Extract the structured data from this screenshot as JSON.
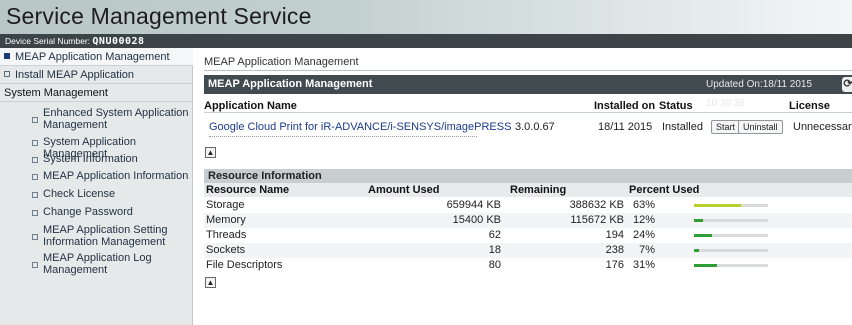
{
  "app_title": "Service Management Service",
  "serial": {
    "label": "Device Serial Number:",
    "value": "QNU00028"
  },
  "sidebar": {
    "top_items": [
      {
        "label": "MEAP Application Management",
        "active": true
      },
      {
        "label": "Install MEAP Application",
        "active": false
      }
    ],
    "section_header": "System Management",
    "sub_items": [
      {
        "label": "Enhanced System Application Management"
      },
      {
        "label": "System Application Management"
      },
      {
        "label": "System Information"
      },
      {
        "label": "MEAP Application Information"
      },
      {
        "label": "Check License"
      },
      {
        "label": "Change Password"
      },
      {
        "label": "MEAP Application Setting Information Management"
      },
      {
        "label": "MEAP Application Log Management"
      }
    ]
  },
  "main": {
    "breadcrumb": "MEAP Application Management",
    "panel_title": "MEAP Application Management",
    "updated": "Updated On:18/11 2015 10:39:38",
    "app_table": {
      "headers": {
        "name": "Application Name",
        "installed_on": "Installed on",
        "status": "Status",
        "license": "License"
      },
      "rows": [
        {
          "name": "Google Cloud Print for iR-ADVANCE/i-SENSYS/imagePRESS",
          "version": "3.0.0.67",
          "installed_on": "18/11 2015",
          "status": "Installed",
          "start_label": "Start",
          "uninstall_label": "Uninstall",
          "license": "Unnecessary"
        }
      ]
    },
    "resource": {
      "title": "Resource Information",
      "headers": {
        "name": "Resource Name",
        "used": "Amount Used",
        "remaining": "Remaining",
        "percent": "Percent Used"
      },
      "rows": [
        {
          "name": "Storage",
          "used": "659944 KB",
          "remaining": "388632 KB",
          "percent": "63%",
          "fraction": 0.63,
          "color": "#b9cf2a"
        },
        {
          "name": "Memory",
          "used": "15400 KB",
          "remaining": "115672 KB",
          "percent": "12%",
          "fraction": 0.12,
          "color": "#2e9e35"
        },
        {
          "name": "Threads",
          "used": "62",
          "remaining": "194",
          "percent": "24%",
          "fraction": 0.24,
          "color": "#2e9e35"
        },
        {
          "name": "Sockets",
          "used": "18",
          "remaining": "238",
          "percent": "7%",
          "fraction": 0.07,
          "color": "#2e9e35"
        },
        {
          "name": "File Descriptors",
          "used": "80",
          "remaining": "176",
          "percent": "31%",
          "fraction": 0.31,
          "color": "#2e9e35"
        }
      ]
    }
  }
}
